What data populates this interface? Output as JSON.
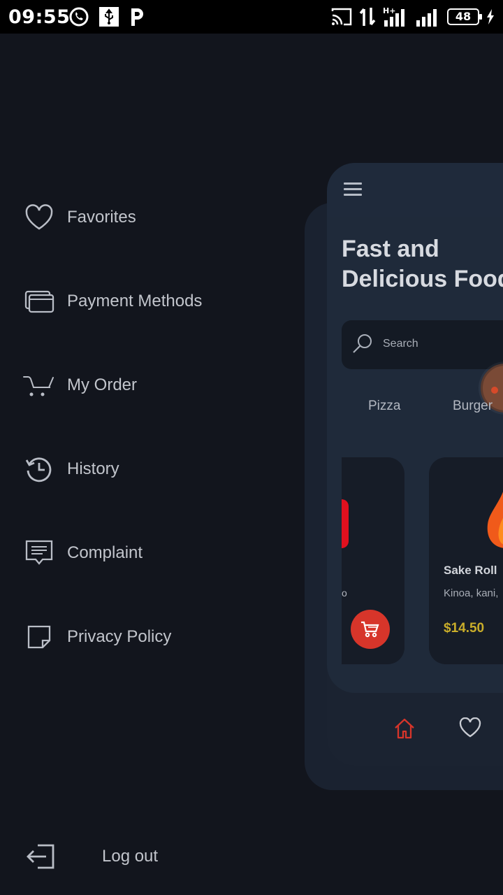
{
  "status_bar": {
    "time": "09:55",
    "battery": "48",
    "network": "H+"
  },
  "drawer": {
    "items": [
      {
        "label": "Favorites",
        "icon": "heart-outline-icon"
      },
      {
        "label": "Payment Methods",
        "icon": "cards-icon"
      },
      {
        "label": "My Order",
        "icon": "cart-outline-icon"
      },
      {
        "label": "History",
        "icon": "history-icon"
      },
      {
        "label": "Complaint",
        "icon": "comment-icon"
      },
      {
        "label": "Privacy Policy",
        "icon": "note-icon"
      }
    ],
    "logout": {
      "label": "Log out",
      "icon": "logout-icon"
    }
  },
  "app_preview": {
    "headline": "Fast and\nDelicious Food",
    "search_placeholder": "Search",
    "categories": [
      "Pizza",
      "Burger"
    ],
    "left_card_text": "o",
    "product": {
      "name": "Sake Roll",
      "description": "Kinoa, kani,",
      "price": "$14.50"
    }
  },
  "colors": {
    "background": "#12151d",
    "accent_red": "#d7352a",
    "price_gold": "#c9ad2a"
  }
}
